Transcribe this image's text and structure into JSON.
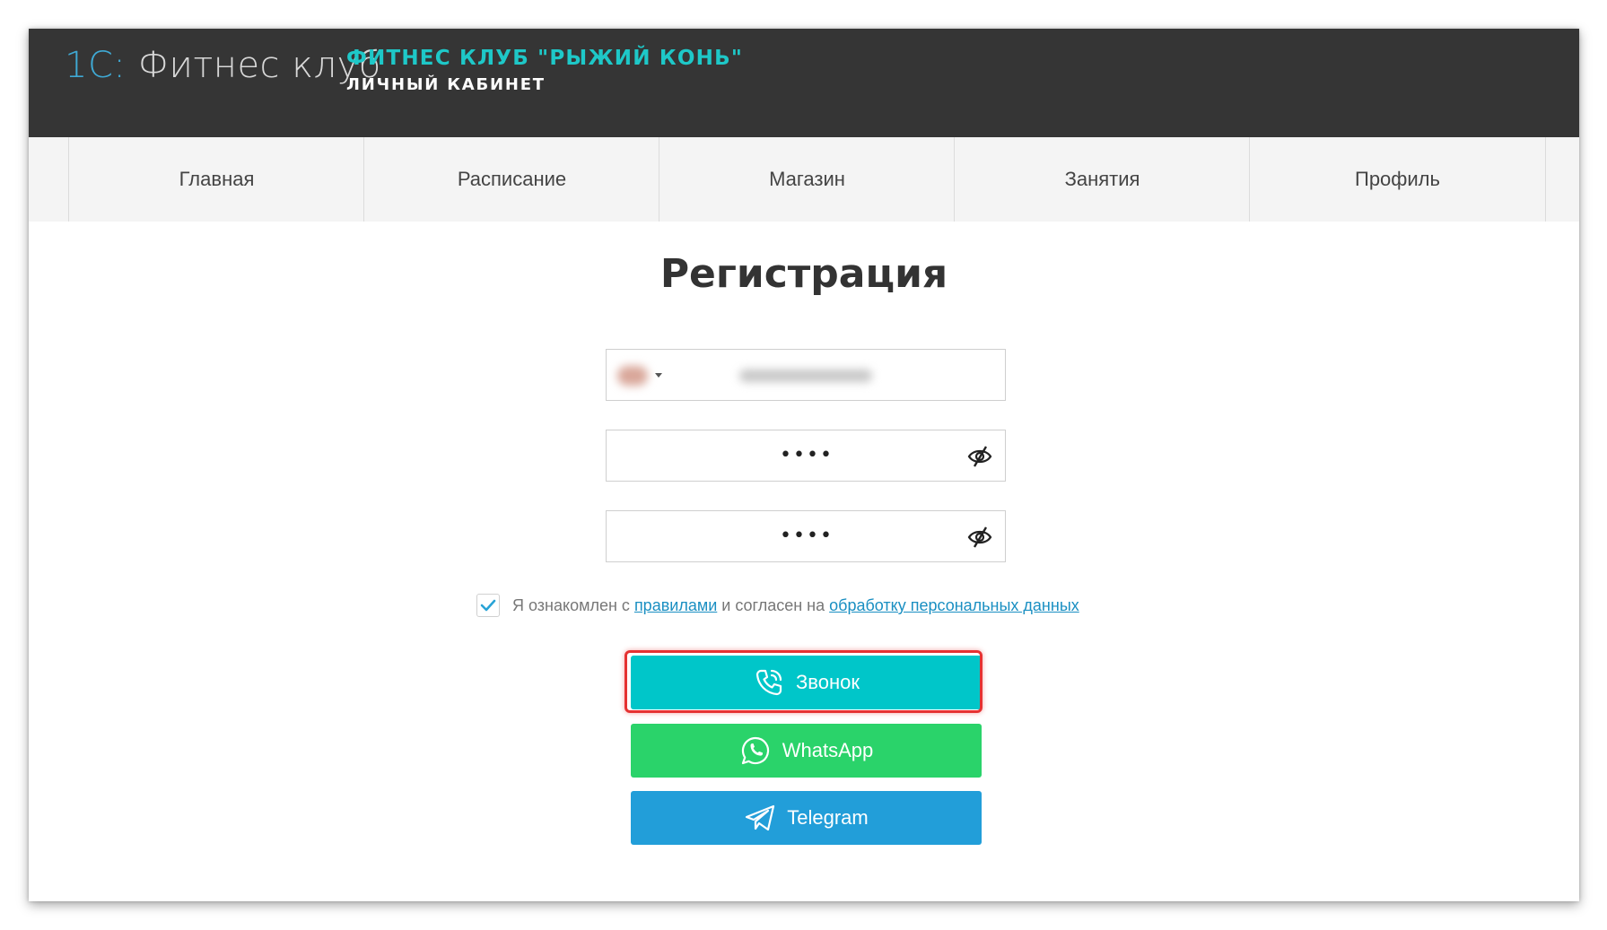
{
  "header": {
    "logo_prefix": "1С:",
    "logo_text": " Фитнес клуб",
    "club_title": "ФИТНЕС КЛУБ \"РЫЖИЙ КОНЬ\"",
    "club_subtitle": "ЛИЧНЫЙ КАБИНЕТ",
    "bg_color": "#353535",
    "title_color": "#1ec8c8"
  },
  "nav": {
    "items": [
      {
        "label": "Главная"
      },
      {
        "label": "Расписание"
      },
      {
        "label": "Магазин"
      },
      {
        "label": "Занятия"
      },
      {
        "label": "Профиль"
      }
    ]
  },
  "page": {
    "title": "Регистрация"
  },
  "form": {
    "password_mask": "••••",
    "password_confirm_mask": "••••",
    "eye_icon": "eye-slash-icon",
    "consent": {
      "checked": true,
      "text_before": "Я ознакомлен с ",
      "rules_link": "правилами",
      "text_middle": " и согласен на ",
      "data_link": "обработку персональных данных"
    }
  },
  "buttons": {
    "call_label": "Звонок",
    "whatsapp_label": "WhatsApp",
    "telegram_label": "Telegram",
    "call_color": "#00c6c9",
    "whatsapp_color": "#2ad36a",
    "telegram_color": "#229ed9",
    "highlight_color": "#e53232"
  }
}
